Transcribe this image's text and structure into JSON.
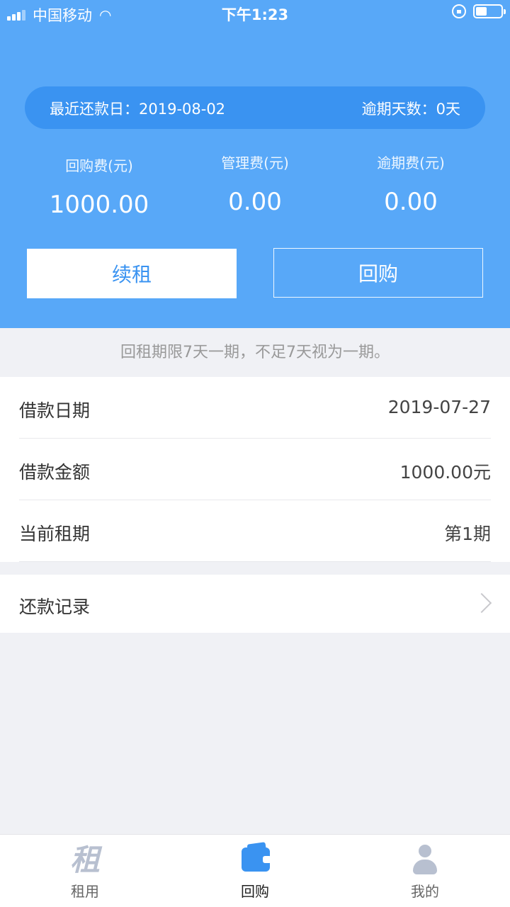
{
  "status_bar": {
    "carrier": "中国移动",
    "time": "下午1:23"
  },
  "summary": {
    "due_label": "最近还款日：",
    "due_date": "2019-08-02",
    "overdue_label": "逾期天数：",
    "overdue_days": "0天",
    "fees": [
      {
        "label": "回购费(元)",
        "value": "1000.00"
      },
      {
        "label": "管理费(元)",
        "value": "0.00"
      },
      {
        "label": "逾期费(元)",
        "value": "0.00"
      }
    ],
    "renew_label": "续租",
    "buyback_label": "回购"
  },
  "notice": "回租期限7天一期，不足7天视为一期。",
  "info_rows": [
    {
      "key": "借款日期",
      "value": "2019-07-27"
    },
    {
      "key": "借款金额",
      "value": "1000.00元"
    },
    {
      "key": "当前租期",
      "value": "第1期"
    }
  ],
  "record": {
    "label": "还款记录"
  },
  "tabbar": {
    "tabs": [
      {
        "label": "租用",
        "icon": "zu-icon",
        "icon_glyph": "租"
      },
      {
        "label": "回购",
        "icon": "wallet-icon"
      },
      {
        "label": "我的",
        "icon": "person-icon"
      }
    ],
    "active_index": 1
  },
  "colors": {
    "header_bg": "#58a8f8",
    "pill_bg": "#3a93f1",
    "accent": "#3a93f1"
  }
}
